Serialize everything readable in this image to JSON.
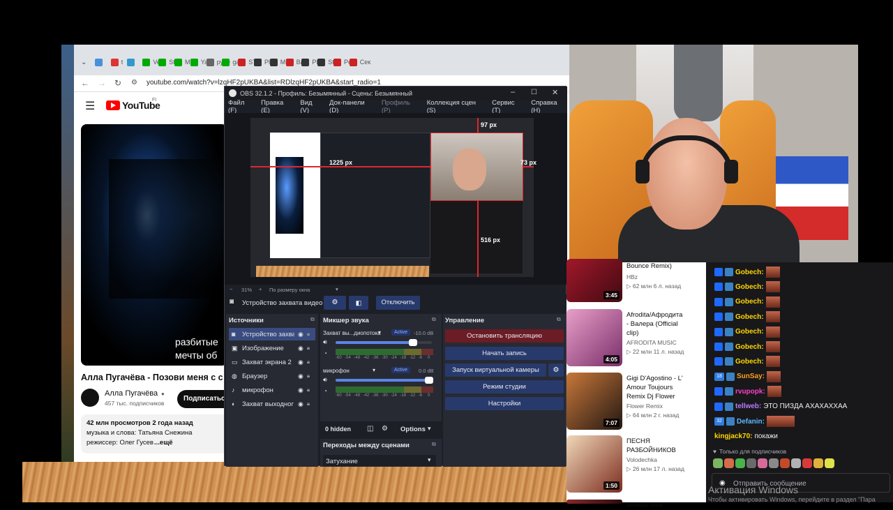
{
  "chrome": {
    "tabs": [
      {
        "label": "",
        "color": "#4a90d9"
      },
      {
        "label": "t",
        "color": "#d33"
      },
      {
        "label": "",
        "color": "#39c"
      },
      {
        "label": "Vers",
        "color": "#0a0"
      },
      {
        "label": "Stre",
        "color": "#0a0"
      },
      {
        "label": "Mo",
        "color": "#0a0"
      },
      {
        "label": "Yas",
        "color": "#0a0"
      },
      {
        "label": "руле",
        "color": "#666"
      },
      {
        "label": "gar",
        "color": "#0a0"
      },
      {
        "label": "STA",
        "color": "#c22"
      },
      {
        "label": "Play",
        "color": "#333"
      },
      {
        "label": "Min",
        "color": "#333"
      },
      {
        "label": "Bau",
        "color": "#c22"
      },
      {
        "label": "Play",
        "color": "#333"
      },
      {
        "label": "Stal",
        "color": "#333"
      },
      {
        "label": "Pea",
        "color": "#c22"
      },
      {
        "label": "Сек",
        "color": "#c22"
      }
    ],
    "url": "youtube.com/watch?v=lzqHF2pUKBA&list=RDlzqHF2pUKBA&start_radio=1"
  },
  "youtube": {
    "logo": "YouTube",
    "region": "FI",
    "overlay_line1": "разбитые",
    "overlay_line2": "мечты об",
    "video_title": "Алла Пугачёва - Позови меня с с",
    "channel": "Алла Пугачёва",
    "subs": "457 тыс. подписчиков",
    "subscribe": "Подписаться",
    "views": "42 млн просмотров  2 года назад",
    "desc1": "музыка и слова: Татьяна Снежина",
    "desc2": "режиссер: Олег Гусев",
    "more": "...ещё"
  },
  "obs": {
    "title": "OBS 32.1.2 - Профиль: Безымянный - Сцены: Безымянный",
    "menu": [
      "Файл (F)",
      "Правка (E)",
      "Вид (V)",
      "Док-панели (D)",
      "Профиль (P)",
      "Коллекция сцен (S)",
      "Сервис (T)",
      "Справка (H)"
    ],
    "preview": {
      "w_label": "97 px",
      "h_label": "73 px",
      "left_label": "1225 px",
      "bottom_label": "516 px"
    },
    "zoom": "31%",
    "zoom_mode": "По размеру окна",
    "source_toolbar": {
      "name": "Устройство захвата видео",
      "disconnect": "Отключить"
    },
    "sources_title": "Источники",
    "sources": [
      "Устройство захва",
      "Изображение",
      "Захват экрана 2",
      "Браузер",
      "микрофон",
      "Захват выходног"
    ],
    "mixer_title": "Микшер звука",
    "mixer": [
      {
        "name": "Захват вы...диопотока",
        "status": "Active",
        "db": "-10.0 dB",
        "level": 0.83
      },
      {
        "name": "микрофон",
        "status": "Active",
        "db": "0.0 dB",
        "level": 1.0
      }
    ],
    "meter_ticks": [
      "-60",
      "-54",
      "-48",
      "-42",
      "-36",
      "-30",
      "-24",
      "-18",
      "-12",
      "-6",
      "0"
    ],
    "hidden": "0 hidden",
    "options": "Options",
    "transitions_title": "Переходы между сценами",
    "transition": "Затухание",
    "controls_title": "Управление",
    "controls": [
      "Остановить трансляцию",
      "Начать запись",
      "Запуск виртуальной камеры",
      "Режим студии",
      "Настройки"
    ]
  },
  "recs": [
    {
      "title1": "Bounce Remix)",
      "title2": "",
      "channel": "HBz",
      "stats": "▷ 62 млн  6 л. назад",
      "duration": "3:45"
    },
    {
      "title1": "Afrodita/Афродита",
      "title2": "- Валера (Official",
      "title3": "clip)",
      "channel": "AFRODITA MUSIC",
      "stats": "▷ 22 млн  11 л. назад",
      "duration": "4:05"
    },
    {
      "title1": "Gigi D'Agostino - L'",
      "title2": "Amour Toujours",
      "title3": "Remix Dj Flower",
      "channel": "Flower Remix",
      "stats": "▷ 64 млн  2 г. назад",
      "duration": "7:07"
    },
    {
      "title1": "ПЕСНЯ",
      "title2": "РАЗБОЙНИКОВ",
      "title3": "",
      "channel": "Volodechka",
      "stats": "▷ 26 млн  17 л. назад",
      "duration": "1:50"
    },
    {
      "title1": "ARMIN VAN",
      "title2": "",
      "title3": "",
      "channel": "",
      "stats": "",
      "duration": ""
    }
  ],
  "chat": {
    "lines": [
      {
        "user": "Gobech:",
        "color": "#ffd700",
        "text": ""
      },
      {
        "user": "Gobech:",
        "color": "#ffd700",
        "text": ""
      },
      {
        "user": "Gobech:",
        "color": "#ffd700",
        "text": ""
      },
      {
        "user": "Gobech:",
        "color": "#ffd700",
        "text": ""
      },
      {
        "user": "Gobech:",
        "color": "#ffd700",
        "text": ""
      },
      {
        "user": "Gobech:",
        "color": "#ffd700",
        "text": ""
      },
      {
        "user": "Gobech:",
        "color": "#ffd700",
        "text": ""
      },
      {
        "user": "SunSay:",
        "color": "#ff9f1a",
        "text": "",
        "badge": "18"
      },
      {
        "user": "rvupopk:",
        "color": "#ff3ec8",
        "text": ""
      },
      {
        "user": "tellweb:",
        "color": "#b77bff",
        "text": "ЭТО ПИЗДА АХАХАХХАА"
      },
      {
        "user": "Defanin:",
        "color": "#5fb7ff",
        "text": "",
        "badge": "32"
      },
      {
        "user": "kingjack70:",
        "color": "#ffd700",
        "text": "покажи"
      }
    ],
    "subs_only": "Только для подписчиков",
    "input_placeholder": "Отправить сообщение"
  },
  "windows": {
    "activate": "Активация Windows",
    "activate_sub": "Чтобы активировать Windows, перейдите в раздел \"Пара"
  }
}
